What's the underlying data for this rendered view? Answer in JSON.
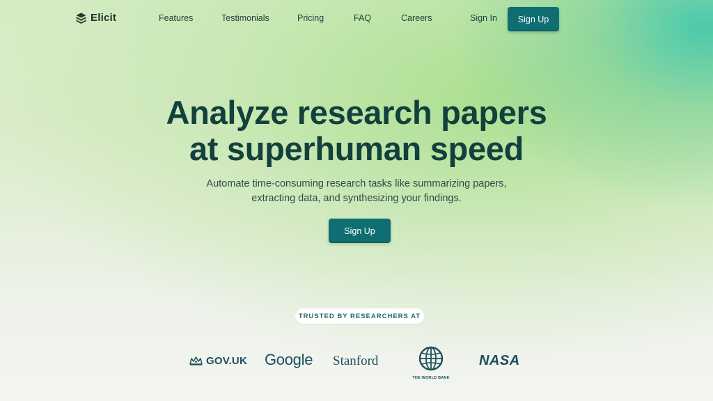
{
  "brand": {
    "name": "Elicit",
    "icon": "elicit-logo-icon"
  },
  "nav": {
    "links": [
      "Features",
      "Testimonials",
      "Pricing",
      "FAQ",
      "Careers"
    ],
    "sign_in": "Sign In",
    "sign_up": "Sign Up"
  },
  "hero": {
    "title_line1": "Analyze research papers",
    "title_line2": "at superhuman speed",
    "subtitle_line1": "Automate time-consuming research tasks like summarizing papers,",
    "subtitle_line2": "extracting data, and synthesizing your findings.",
    "cta": "Sign Up"
  },
  "trusted": {
    "label": "TRUSTED BY RESEARCHERS AT",
    "logos": {
      "gov_uk": "GOV.UK",
      "google": "Google",
      "stanford": "Stanford",
      "world_bank": "THE WORLD BANK",
      "nasa": "NASA"
    }
  },
  "colors": {
    "primary_button": "#0f6e72",
    "heading": "#12403c",
    "logo_tint": "#1d4f5b"
  }
}
